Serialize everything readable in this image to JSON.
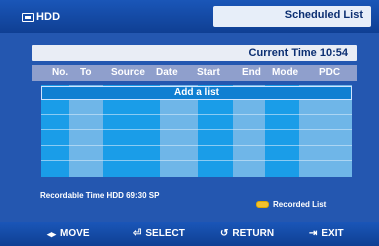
{
  "window": {
    "device_label": "HDD",
    "title": "Scheduled List"
  },
  "status": {
    "current_time_label": "Current Time 10:54"
  },
  "table": {
    "columns": [
      "No.",
      "To",
      "Source",
      "Date",
      "Start",
      "End",
      "Mode",
      "PDC"
    ],
    "add_label": "Add a list"
  },
  "info": {
    "recordable_time": "Recordable Time  HDD 69:30 SP",
    "recorded_list": "Recorded List"
  },
  "nav": {
    "move": "MOVE",
    "select": "SELECT",
    "return": "RETURN",
    "exit": "EXIT"
  },
  "colors": {
    "background_blue": "#2457b0",
    "table_blue": "#1a9de8",
    "stripe_blue": "#6fb6e8",
    "accent_yellow": "#f2c12e"
  },
  "icons": {
    "hdd": "hdd-icon",
    "move": "left-right-arrow-icon",
    "select": "select-icon",
    "return": "return-icon",
    "exit": "exit-icon",
    "yellow_key": "yellow-button-icon"
  }
}
